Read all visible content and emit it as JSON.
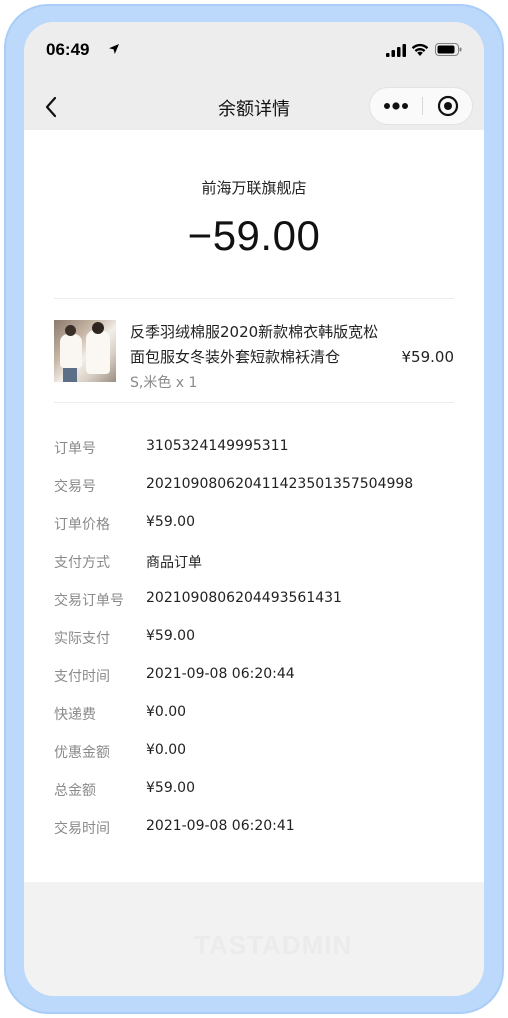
{
  "status_bar": {
    "time": "06:49"
  },
  "nav": {
    "title": "余额详情"
  },
  "transaction": {
    "merchant": "前海万联旗舰店",
    "amount": "−59.00"
  },
  "product": {
    "title": "反季羽绒棉服2020新款棉衣韩版宽松面包服女冬装外套短款棉袄清仓",
    "price": "¥59.00",
    "spec": "S,米色 x 1"
  },
  "details": [
    {
      "label": "订单号",
      "value": "3105324149995311"
    },
    {
      "label": "交易号",
      "value": "2021090806204114235013575049​98"
    },
    {
      "label": "订单价格",
      "value": "¥59.00"
    },
    {
      "label": "支付方式",
      "value": "商品订单"
    },
    {
      "label": "交易订单号",
      "value": "2021090806204493561431"
    },
    {
      "label": "实际支付",
      "value": "¥59.00"
    },
    {
      "label": "支付时间",
      "value": "2021-09-08 06:20:44"
    },
    {
      "label": "快递费",
      "value": "¥0.00"
    },
    {
      "label": "优惠金额",
      "value": "¥0.00"
    },
    {
      "label": "总金额",
      "value": "¥59.00"
    },
    {
      "label": "交易时间",
      "value": "2021-09-08 06:20:41"
    }
  ],
  "watermark": "TASTADMIN",
  "icons": {
    "back": "chevron-left-icon",
    "more": "more-dots-icon",
    "close": "target-close-icon",
    "signal": "signal-icon",
    "wifi": "wifi-icon",
    "battery": "battery-icon",
    "location": "location-arrow-icon"
  }
}
